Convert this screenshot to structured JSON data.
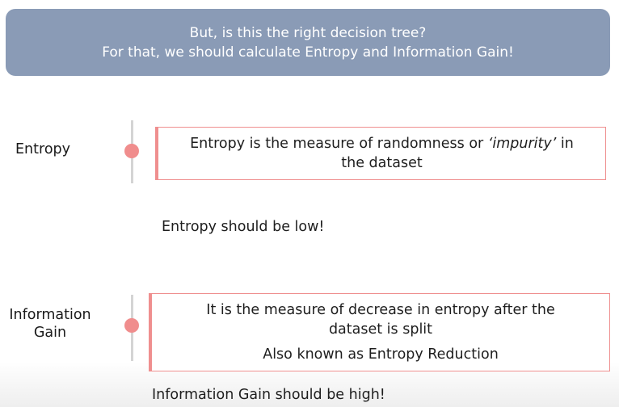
{
  "banner": {
    "line1": "But, is this the right decision tree?",
    "line2": "For that, we should calculate Entropy and Information Gain!"
  },
  "entropy": {
    "label": "Entropy",
    "definition_pre": "Entropy is the measure of randomness or",
    "definition_italic": "‘impurity’",
    "definition_post": "in",
    "definition_line2": "the dataset",
    "note": "Entropy should be low!"
  },
  "information_gain": {
    "label_line1": "Information",
    "label_line2": "Gain",
    "definition_line1": "It is the measure of decrease in entropy after the",
    "definition_line2": "dataset is split",
    "alias": "Also known as Entropy Reduction",
    "note": "Information Gain should be high!"
  },
  "colors": {
    "banner_bg": "#8a9bb6",
    "accent": "#ef8f8f",
    "timeline": "#d4d4d4"
  }
}
